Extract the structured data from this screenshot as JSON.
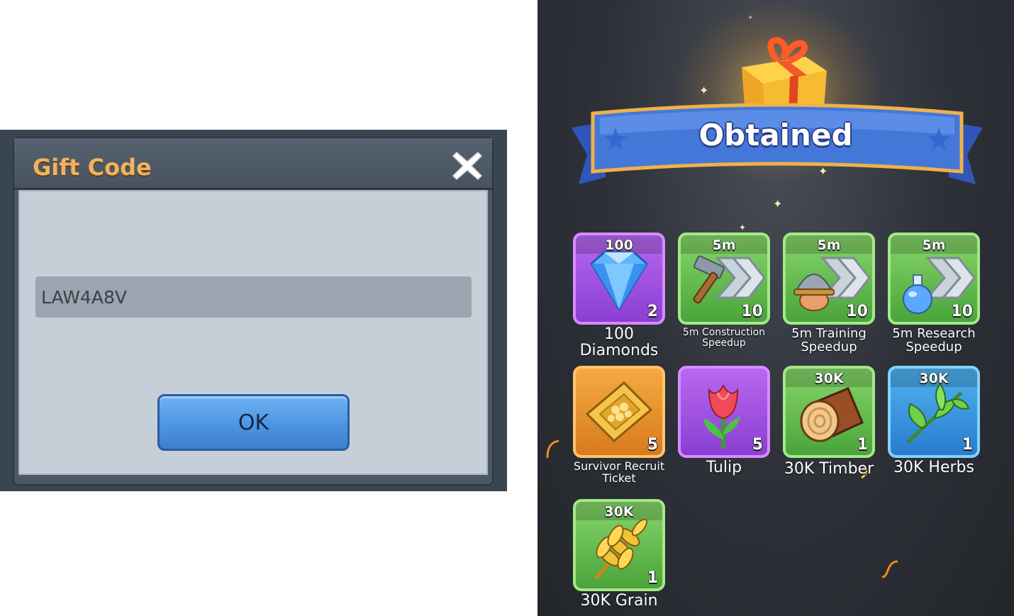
{
  "gift_dialog": {
    "title": "Gift Code",
    "code_value": "LAW4A8V",
    "ok_label": "OK",
    "close_icon": "close-x-icon"
  },
  "obtained": {
    "title": "Obtained",
    "rewards": [
      {
        "amount": "100",
        "qty": "2",
        "name": "100 Diamonds",
        "icon": "diamond-icon",
        "color": "purple"
      },
      {
        "amount": "5m",
        "qty": "10",
        "name": "5m Construction Speedup",
        "icon": "hammer-speedup-icon",
        "color": "green"
      },
      {
        "amount": "5m",
        "qty": "10",
        "name": "5m Training Speedup",
        "icon": "helmet-speedup-icon",
        "color": "green"
      },
      {
        "amount": "5m",
        "qty": "10",
        "name": "5m Research Speedup",
        "icon": "flask-speedup-icon",
        "color": "green"
      },
      {
        "amount": "",
        "qty": "5",
        "name": "Survivor Recruit Ticket",
        "icon": "recruit-ticket-icon",
        "color": "orange"
      },
      {
        "amount": "",
        "qty": "5",
        "name": "Tulip",
        "icon": "tulip-icon",
        "color": "purple"
      },
      {
        "amount": "30K",
        "qty": "1",
        "name": "30K Timber",
        "icon": "timber-log-icon",
        "color": "green"
      },
      {
        "amount": "30K",
        "qty": "1",
        "name": "30K Herbs",
        "icon": "herbs-icon",
        "color": "blue"
      },
      {
        "amount": "30K",
        "qty": "1",
        "name": "30K Grain",
        "icon": "grain-icon",
        "color": "green"
      }
    ]
  },
  "colors": {
    "title_gold": "#f1b25e",
    "ok_blue": "#4d95e2",
    "banner_blue": "#3f6bd0"
  }
}
